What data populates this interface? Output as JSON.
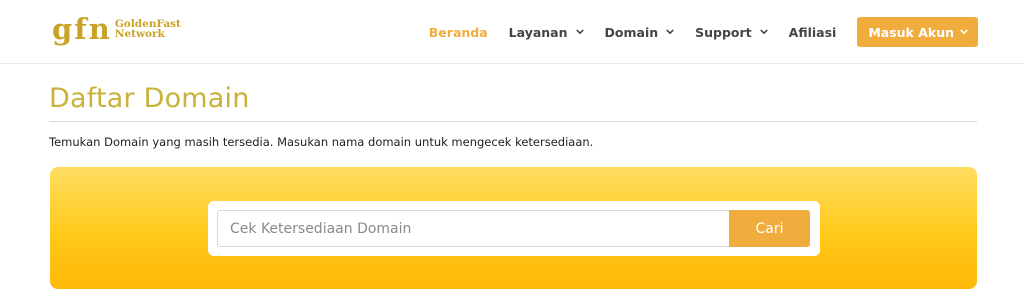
{
  "logo": {
    "mark": "gfn",
    "line1": "GoldenFast",
    "line2": "Network"
  },
  "nav": {
    "items": [
      {
        "label": "Beranda",
        "dropdown": false,
        "active": true
      },
      {
        "label": "Layanan",
        "dropdown": true,
        "active": false
      },
      {
        "label": "Domain",
        "dropdown": true,
        "active": false
      },
      {
        "label": "Support",
        "dropdown": true,
        "active": false
      },
      {
        "label": "Afiliasi",
        "dropdown": false,
        "active": false
      }
    ],
    "login_label": "Masuk Akun"
  },
  "page": {
    "title": "Daftar Domain",
    "intro": "Temukan Domain yang masih tersedia. Masukan nama domain untuk mengecek ketersediaan."
  },
  "search": {
    "value": "",
    "placeholder": "Cek Ketersediaan Domain",
    "button_label": "Cari"
  },
  "colors": {
    "accent": "#f0ad3e",
    "title": "#c9b13a",
    "logo": "#c9a227",
    "panel_top": "#ffdd62",
    "panel_bottom": "#ffb808"
  }
}
